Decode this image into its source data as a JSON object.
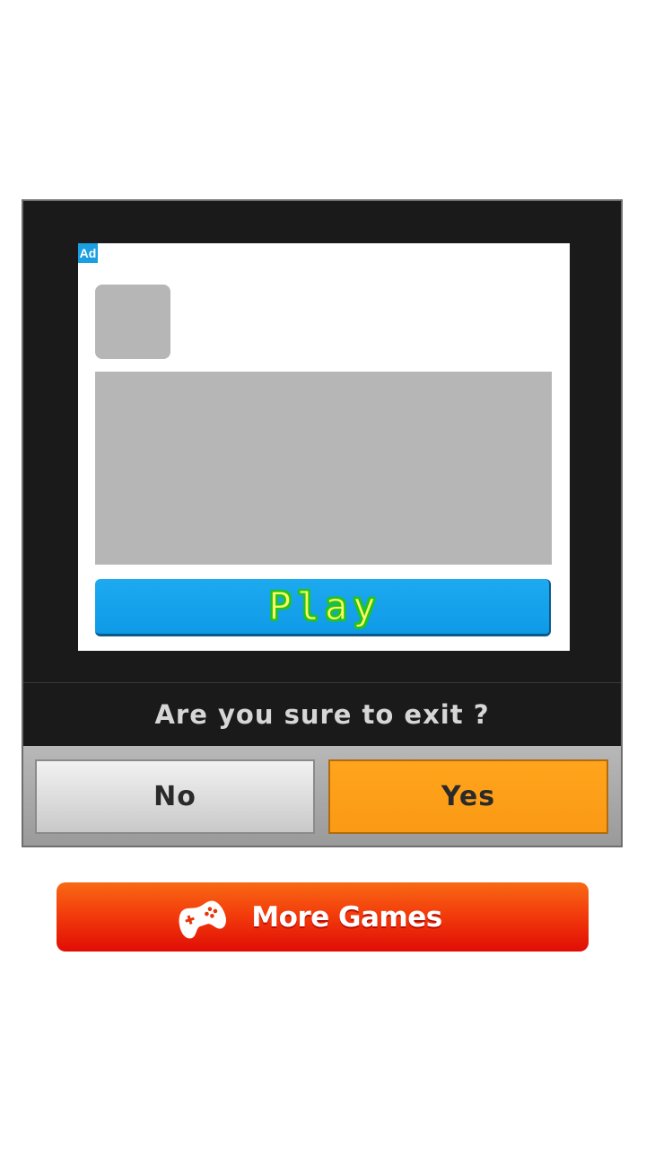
{
  "ad": {
    "badge": "Ad",
    "cta_label": "Play"
  },
  "dialog": {
    "question": "Are you sure to exit ?",
    "no_label": "No",
    "yes_label": "Yes"
  },
  "more_games": {
    "label": "More Games",
    "icon": "gamepad-icon"
  },
  "colors": {
    "play_button": "#0e9ae6",
    "play_text": "#fff866",
    "play_text_outline": "#22c41c",
    "yes_button": "#fb9a14",
    "no_button": "#dcdcdc",
    "dialog_bg": "#1a1a1a",
    "more_games_top": "#f86a14",
    "more_games_bottom": "#e00d05"
  }
}
